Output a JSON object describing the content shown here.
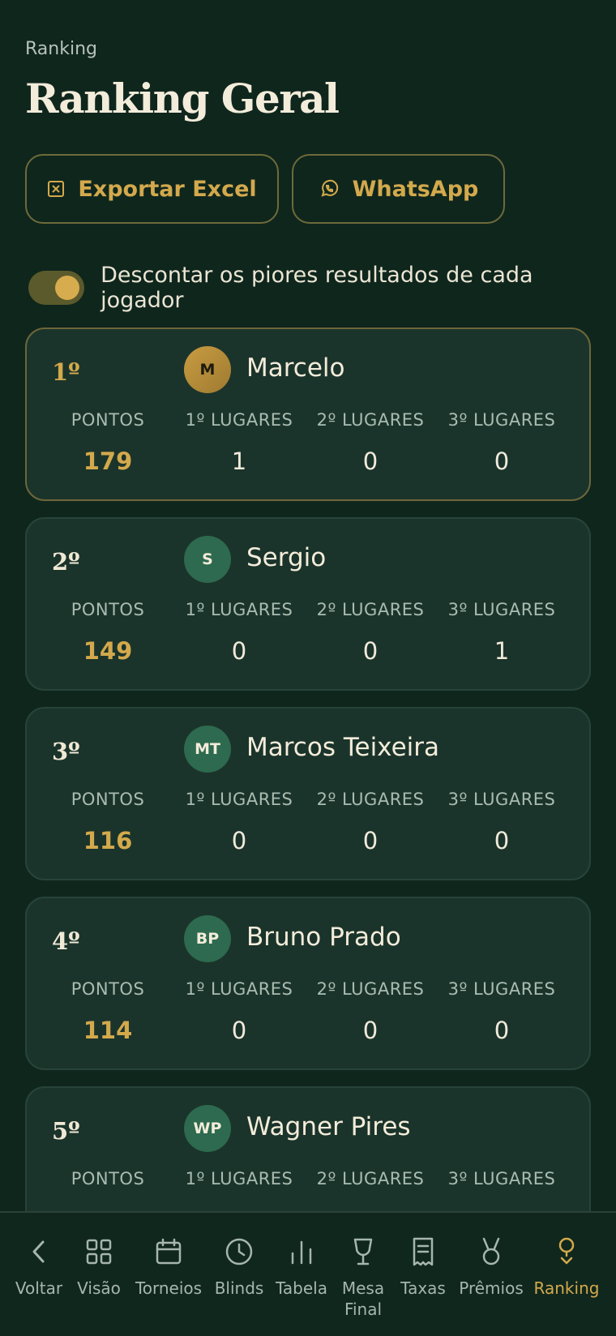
{
  "breadcrumb": "Ranking",
  "title": "Ranking Geral",
  "actions": {
    "excel_label": "Exportar Excel",
    "whatsapp_label": "WhatsApp"
  },
  "toggle": {
    "label": "Descontar os piores resultados de cada jogador",
    "enabled": true
  },
  "stat_labels": {
    "points": "PONTOS",
    "first": "1º LUGARES",
    "second": "2º LUGARES",
    "third": "3º LUGARES"
  },
  "players": [
    {
      "rank": "1º",
      "initials": "M",
      "name": "Marcelo",
      "points": "179",
      "first": "1",
      "second": "0",
      "third": "0"
    },
    {
      "rank": "2º",
      "initials": "S",
      "name": "Sergio",
      "points": "149",
      "first": "0",
      "second": "0",
      "third": "1"
    },
    {
      "rank": "3º",
      "initials": "MT",
      "name": "Marcos Teixeira",
      "points": "116",
      "first": "0",
      "second": "0",
      "third": "0"
    },
    {
      "rank": "4º",
      "initials": "BP",
      "name": "Bruno Prado",
      "points": "114",
      "first": "0",
      "second": "0",
      "third": "0"
    },
    {
      "rank": "5º",
      "initials": "WP",
      "name": "Wagner Pires"
    }
  ],
  "nav": [
    {
      "label": "Voltar",
      "icon": "chevron-left-icon"
    },
    {
      "label": "Visão",
      "icon": "grid-icon"
    },
    {
      "label": "Torneios",
      "icon": "calendar-icon"
    },
    {
      "label": "Blinds",
      "icon": "clock-icon"
    },
    {
      "label": "Tabela",
      "icon": "bar-chart-icon"
    },
    {
      "label": "Mesa Final",
      "icon": "trophy-cup-icon"
    },
    {
      "label": "Taxas",
      "icon": "receipt-icon"
    },
    {
      "label": "Prêmios",
      "icon": "medal-icon"
    },
    {
      "label": "Ranking",
      "icon": "ranking-medal-icon",
      "active": true
    }
  ],
  "colors": {
    "background": "#0f261d",
    "card": "#1b342b",
    "accent": "#d3a94c",
    "avatar": "#2d6a4f"
  }
}
